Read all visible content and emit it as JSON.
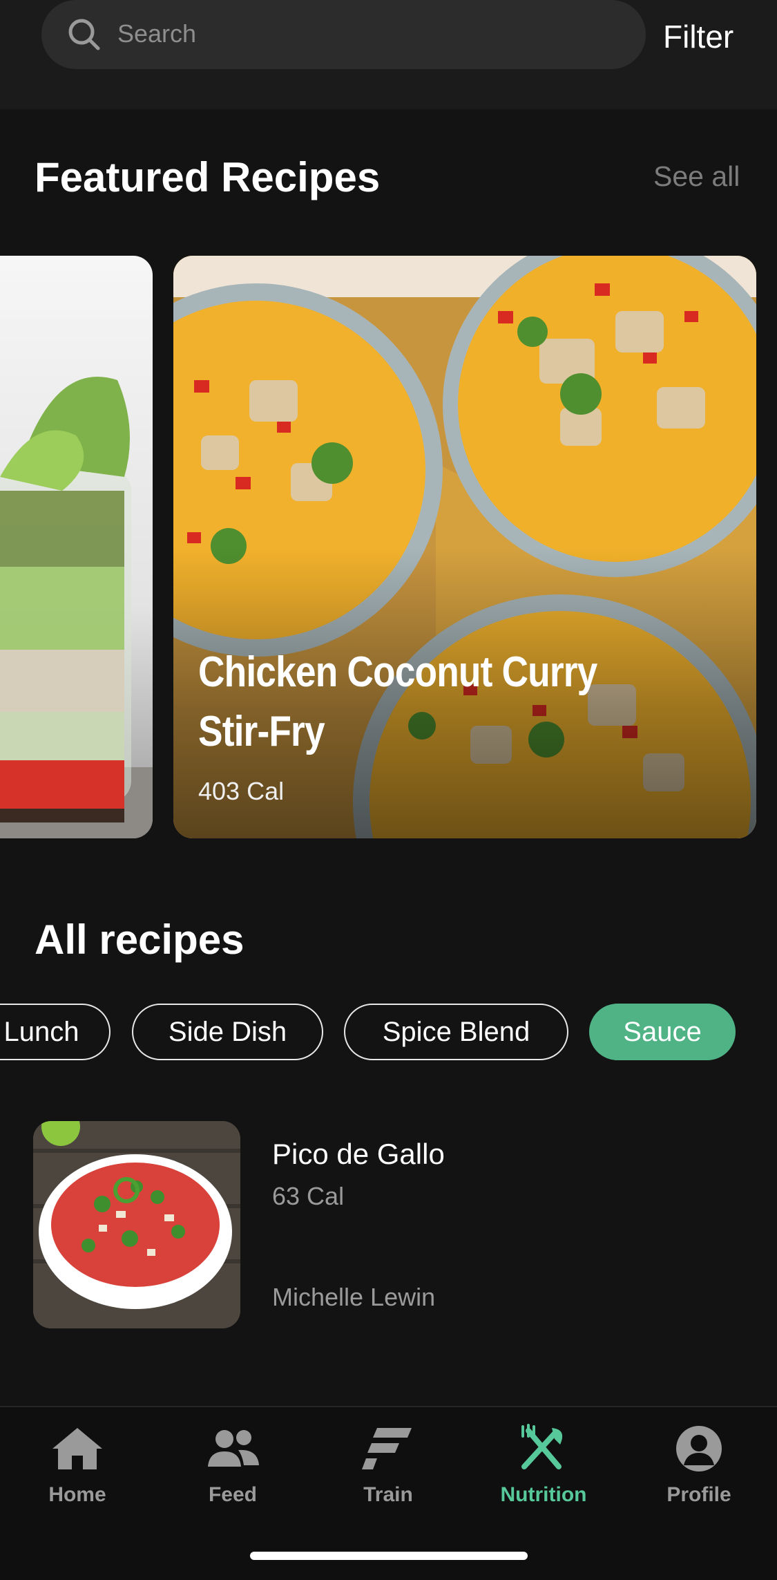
{
  "search": {
    "placeholder": "Search",
    "filter_label": "Filter"
  },
  "featured": {
    "title": "Featured Recipes",
    "see_all_label": "See all",
    "cards": [
      {
        "image": "layered-salad-jar"
      },
      {
        "title": "Chicken Coconut Curry Stir-Fry",
        "calories": "403 Cal",
        "image": "curry-bowls"
      }
    ]
  },
  "all_recipes": {
    "title": "All recipes",
    "chips": [
      {
        "label": "Lunch",
        "active": false
      },
      {
        "label": "Side Dish",
        "active": false
      },
      {
        "label": "Spice Blend",
        "active": false
      },
      {
        "label": "Sauce",
        "active": true
      }
    ],
    "items": [
      {
        "name": "Pico de Gallo",
        "calories": "63 Cal",
        "author": "Michelle Lewin",
        "image": "pico-de-gallo-bowl"
      }
    ]
  },
  "tabs": [
    {
      "label": "Home",
      "icon": "home-icon",
      "active": false
    },
    {
      "label": "Feed",
      "icon": "people-icon",
      "active": false
    },
    {
      "label": "Train",
      "icon": "train-icon",
      "active": false
    },
    {
      "label": "Nutrition",
      "icon": "fork-knife-icon",
      "active": true
    },
    {
      "label": "Profile",
      "icon": "profile-icon",
      "active": false
    }
  ],
  "colors": {
    "accent": "#57c89a",
    "chip_active": "#4fb386",
    "background": "#131313"
  }
}
